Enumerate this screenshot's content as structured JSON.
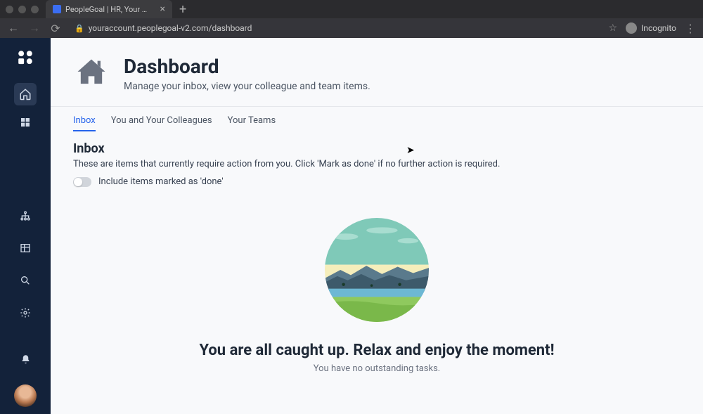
{
  "browser": {
    "tab_title": "PeopleGoal | HR, Your Way.",
    "url": "youraccount.peoplegoal-v2.com/dashboard",
    "incognito_label": "Incognito"
  },
  "header": {
    "title": "Dashboard",
    "subtitle": "Manage your inbox, view your colleague and team items."
  },
  "tabs": [
    {
      "label": "Inbox",
      "active": true
    },
    {
      "label": "You and Your Colleagues",
      "active": false
    },
    {
      "label": "Your Teams",
      "active": false
    }
  ],
  "inbox": {
    "heading": "Inbox",
    "description": "These are items that currently require action from you. Click 'Mark as done' if no further action is required.",
    "toggle_label": "Include items marked as 'done'"
  },
  "empty_state": {
    "title": "You are all caught up. Relax and enjoy the moment!",
    "subtitle": "You have no outstanding tasks."
  }
}
